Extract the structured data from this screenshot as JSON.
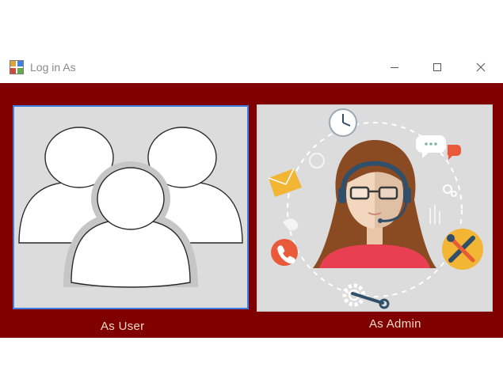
{
  "window": {
    "title": "Log in As",
    "controls": {
      "minimize": "minimize-icon",
      "maximize": "maximize-icon",
      "close": "close-icon"
    }
  },
  "options": {
    "user_label": "As User",
    "admin_label": "As Admin"
  },
  "colors": {
    "background": "#800000",
    "panel": "#dcdcdc",
    "focus_border": "#3f7fe0",
    "label_text": "#f2d9c8"
  }
}
